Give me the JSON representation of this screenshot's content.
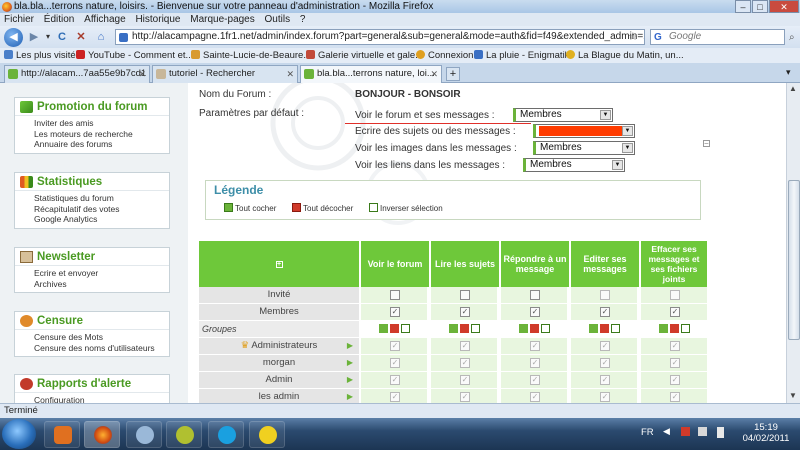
{
  "window": {
    "title": "bla.bla...terrons nature, loisirs. - Bienvenue sur votre panneau d'administration - Mozilla Firefox"
  },
  "menu": [
    "Fichier",
    "Édition",
    "Affichage",
    "Historique",
    "Marque-pages",
    "Outils",
    "?"
  ],
  "nav": {
    "url": "http://alacampagne.1fr1.net/admin/index.forum?part=general&sub=general&mode=auth&fid=f49&extended_admin=1&",
    "search_placeholder": "Google",
    "search_logo": "G"
  },
  "bookmarks": [
    {
      "label": "Les plus visités",
      "color": "#4a7fc9"
    },
    {
      "label": "YouTube - Comment et...",
      "color": "#cc2222"
    },
    {
      "label": "Sainte-Lucie-de-Beaure...",
      "color": "#d89a30"
    },
    {
      "label": "Galerie virtuelle et gale...",
      "color": "#c24a3a"
    },
    {
      "label": "Connexion",
      "color": "#e0a020"
    },
    {
      "label": "La pluie - Enigmatik",
      "color": "#3a6fc4"
    },
    {
      "label": "La Blague du Matin, un...",
      "color": "#e0b020"
    }
  ],
  "tabs": [
    {
      "label": "http://alacam...7aa55e9b7cd1",
      "active": false
    },
    {
      "label": "tutoriel - Rechercher",
      "active": false
    },
    {
      "label": "bla.bla...terrons nature, loi...",
      "active": true
    }
  ],
  "sidebar": [
    {
      "title": "Promotion du forum",
      "icon": "megaphone-icon",
      "items": [
        "Inviter des amis",
        "Les moteurs de recherche",
        "Annuaire des forums"
      ]
    },
    {
      "title": "Statistiques",
      "icon": "chart-icon",
      "items": [
        "Statistiques du forum",
        "Récapitulatif des votes",
        "Google Analytics"
      ]
    },
    {
      "title": "Newsletter",
      "icon": "newsletter-icon",
      "items": [
        "Ecrire et envoyer",
        "Archives"
      ]
    },
    {
      "title": "Censure",
      "icon": "censure-icon",
      "items": [
        "Censure des Mots",
        "Censure des noms d'utilisateurs"
      ]
    },
    {
      "title": "Rapports d'alerte",
      "icon": "alert-icon",
      "items": [
        "Configuration"
      ]
    }
  ],
  "forum": {
    "name_label": "Nom du Forum :",
    "name_value": "BONJOUR - BONSOIR",
    "defaults_label": "Paramètres par défaut :",
    "settings": [
      {
        "label": "Voir le forum et ses messages :",
        "value": "Membres"
      },
      {
        "label": "Ecrire des sujets ou des messages :",
        "value": ""
      },
      {
        "label": "Voir les images dans les messages :",
        "value": "Membres"
      },
      {
        "label": "Voir les liens dans les messages :",
        "value": "Membres"
      }
    ],
    "highlight_color": "#ff3c00"
  },
  "legend": {
    "title": "Légende",
    "check_all": "Tout cocher",
    "uncheck_all": "Tout décocher",
    "invert": "Inverser sélection"
  },
  "perm": {
    "columns": [
      "Voir le forum",
      "Lire les sujets",
      "Répondre à un message",
      "Editer ses messages",
      "Effacer ses messages et ses fichiers joints"
    ],
    "rows": [
      {
        "label": "Invité",
        "checks": [
          false,
          false,
          false,
          false,
          false
        ],
        "disabled": [
          false,
          false,
          false,
          true,
          true
        ]
      },
      {
        "label": "Membres",
        "checks": [
          true,
          true,
          true,
          true,
          true
        ],
        "disabled": [
          false,
          false,
          false,
          false,
          false
        ]
      }
    ],
    "groups_label": "Groupes",
    "groups": [
      {
        "label": "Administrateurs",
        "crown": true
      },
      {
        "label": "morgan",
        "crown": false
      },
      {
        "label": "Admin",
        "crown": false
      },
      {
        "label": "les admin",
        "crown": false
      }
    ]
  },
  "status": "Terminé",
  "taskbar": {
    "lang": "FR",
    "time": "15:19",
    "date": "04/02/2011"
  }
}
